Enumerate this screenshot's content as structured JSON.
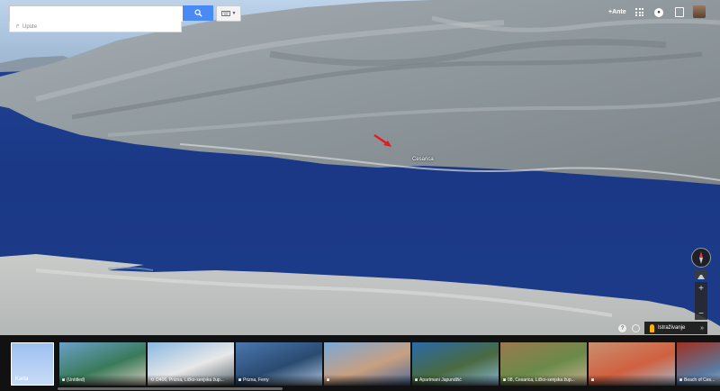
{
  "search": {
    "placeholder": "",
    "button_icon": "search-icon"
  },
  "directions": {
    "label": "Upute",
    "icon": "directions-icon"
  },
  "keyboard": {
    "icon": "keyboard-icon"
  },
  "topbar": {
    "user_link": "+Ante",
    "apps_icon": "apps-grid-icon",
    "notifications_icon": "notifications-icon",
    "share_icon": "share-icon",
    "avatar_icon": "avatar"
  },
  "map": {
    "place_label": "Cesarica",
    "marker_icon": "red-arrow-icon"
  },
  "controls": {
    "compass_icon": "compass-icon",
    "tilt_icon": "tilt-icon",
    "zoom_in": "+",
    "zoom_out": "−",
    "help_icon": "?",
    "settings_icon": "gear-icon"
  },
  "explore": {
    "label": "Istraživanje",
    "chevron": "»"
  },
  "strip": {
    "map_tile_label": "Karta",
    "thumbs": [
      {
        "caption": "(Untitled)",
        "icon": "camera-icon",
        "colors": [
          "#6aa0c8",
          "#3a7a5a",
          "#d8d0c0"
        ]
      },
      {
        "caption": "D406, Prizna, Ličko-senjska žup...",
        "icon": "360-icon",
        "colors": [
          "#8ab8e0",
          "#e8e8e8",
          "#5a6870"
        ]
      },
      {
        "caption": "Prizna, Ferry",
        "icon": "camera-icon",
        "colors": [
          "#4a78b0",
          "#2a4a70",
          "#b0c8e0"
        ]
      },
      {
        "caption": "",
        "icon": "camera-icon",
        "colors": [
          "#7aa8d8",
          "#c8a080",
          "#4a6a9a"
        ]
      },
      {
        "caption": "Apartmani Japundžić",
        "icon": "camera-icon",
        "colors": [
          "#2a6aa8",
          "#4a6a40",
          "#8ab8d8"
        ]
      },
      {
        "caption": "08, Cesarica, Ličko-senjska žup...",
        "icon": "camera-icon",
        "colors": [
          "#9a7a50",
          "#6a8a4a",
          "#c8b090"
        ]
      },
      {
        "caption": "",
        "icon": "camera-icon",
        "colors": [
          "#c89070",
          "#d06040",
          "#a8b8c8"
        ]
      },
      {
        "caption": "Beach of Ces...",
        "icon": "camera-icon",
        "colors": [
          "#a03020",
          "#5a7aa0",
          "#d8d8e0"
        ]
      }
    ]
  }
}
